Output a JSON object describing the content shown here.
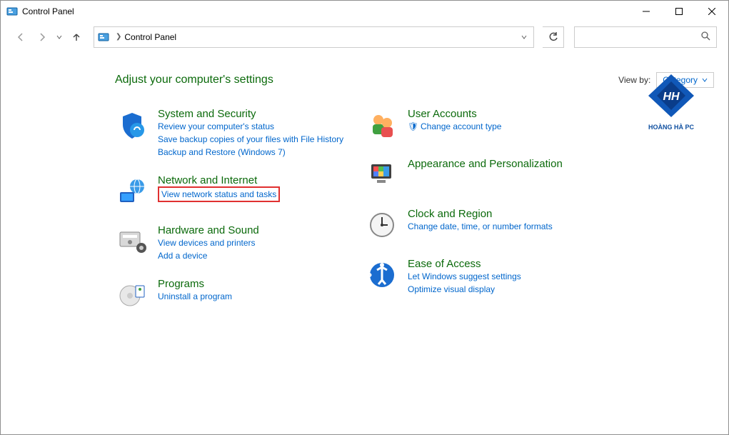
{
  "titlebar": {
    "title": "Control Panel"
  },
  "toolbar": {
    "breadcrumb": "Control Panel",
    "search_placeholder": ""
  },
  "header": {
    "title": "Adjust your computer's settings",
    "viewby_label": "View by:",
    "viewby_value": "Category"
  },
  "logo_text": "HOÀNG HÀ PC",
  "left_categories": [
    {
      "title": "System and Security",
      "links": [
        {
          "text": "Review your computer's status",
          "boxed": false,
          "shield": false
        },
        {
          "text": "Save backup copies of your files with File History",
          "boxed": false,
          "shield": false
        },
        {
          "text": "Backup and Restore (Windows 7)",
          "boxed": false,
          "shield": false
        }
      ]
    },
    {
      "title": "Network and Internet",
      "links": [
        {
          "text": "View network status and tasks",
          "boxed": true,
          "shield": false
        }
      ]
    },
    {
      "title": "Hardware and Sound",
      "links": [
        {
          "text": "View devices and printers",
          "boxed": false,
          "shield": false
        },
        {
          "text": "Add a device",
          "boxed": false,
          "shield": false
        }
      ]
    },
    {
      "title": "Programs",
      "links": [
        {
          "text": "Uninstall a program",
          "boxed": false,
          "shield": false
        }
      ]
    }
  ],
  "right_categories": [
    {
      "title": "User Accounts",
      "links": [
        {
          "text": "Change account type",
          "boxed": false,
          "shield": true
        }
      ]
    },
    {
      "title": "Appearance and Personalization",
      "links": []
    },
    {
      "title": "Clock and Region",
      "links": [
        {
          "text": "Change date, time, or number formats",
          "boxed": false,
          "shield": false
        }
      ]
    },
    {
      "title": "Ease of Access",
      "links": [
        {
          "text": "Let Windows suggest settings",
          "boxed": false,
          "shield": false
        },
        {
          "text": "Optimize visual display",
          "boxed": false,
          "shield": false
        }
      ]
    }
  ]
}
